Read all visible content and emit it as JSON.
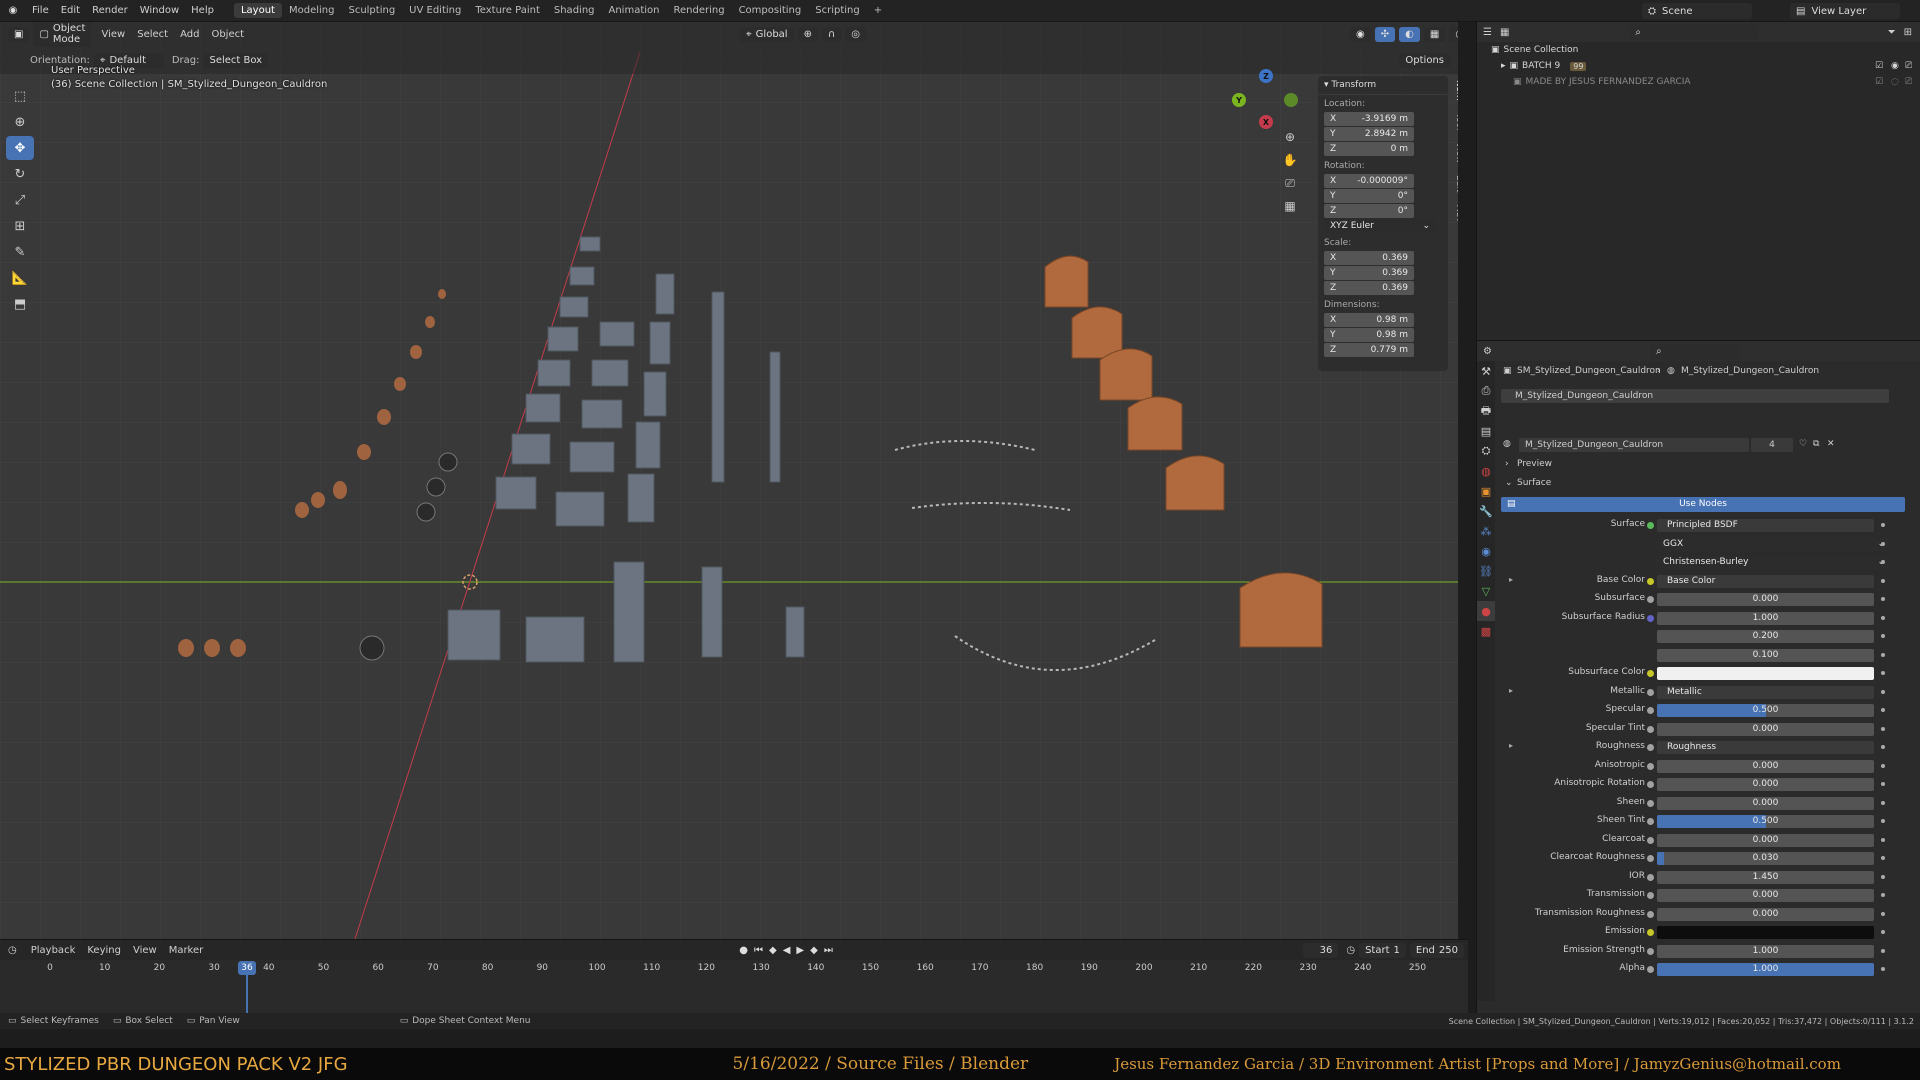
{
  "topbar": {
    "menus": [
      "File",
      "Edit",
      "Render",
      "Window",
      "Help"
    ],
    "workspaces": [
      "Layout",
      "Modeling",
      "Sculpting",
      "UV Editing",
      "Texture Paint",
      "Shading",
      "Animation",
      "Rendering",
      "Compositing",
      "Scripting"
    ],
    "active_workspace": "Layout",
    "add_workspace": "+",
    "scene": "Scene",
    "view_layer": "View Layer"
  },
  "viewport": {
    "mode": "Object Mode",
    "menus": [
      "View",
      "Select",
      "Add",
      "Object"
    ],
    "transform_orientation": "Global",
    "orientation_label": "Orientation:",
    "orientation_value": "Default",
    "drag_label": "Drag:",
    "drag_value": "Select Box",
    "options_label": "Options",
    "view_name": "User Perspective",
    "collection_info": "(36) Scene Collection | SM_Stylized_Dungeon_Cauldron",
    "gizmo": {
      "x": "X",
      "y": "Y",
      "z": "Z"
    }
  },
  "npanel": {
    "title": "Transform",
    "location_label": "Location:",
    "location": {
      "x": "-3.9169 m",
      "y": "2.8942 m",
      "z": "0 m"
    },
    "rotation_label": "Rotation:",
    "rotation": {
      "x": "-0.000009°",
      "y": "0°",
      "z": "0°"
    },
    "rotation_mode": "XYZ Euler",
    "scale_label": "Scale:",
    "scale": {
      "x": "0.369",
      "y": "0.369",
      "z": "0.369"
    },
    "dimensions_label": "Dimensions:",
    "dimensions": {
      "x": "0.98 m",
      "y": "0.98 m",
      "z": "0.779 m"
    },
    "axis": {
      "x": "X",
      "y": "Y",
      "z": "Z"
    },
    "tabs": [
      "Item",
      "Tool",
      "View",
      "Edit",
      "ACT"
    ]
  },
  "outliner": {
    "root": "Scene Collection",
    "items": [
      {
        "label": "BATCH 9",
        "badge": "99"
      },
      {
        "label": "MADE BY JESUS FERNANDEZ GARCIA"
      }
    ]
  },
  "properties": {
    "breadcrumb_object": "SM_Stylized_Dungeon_Cauldron",
    "breadcrumb_material": "M_Stylized_Dungeon_Cauldron",
    "slot": "M_Stylized_Dungeon_Cauldron",
    "material_name": "M_Stylized_Dungeon_Cauldron",
    "user_count": "4",
    "preview_label": "Preview",
    "surface_label": "Surface",
    "use_nodes": "Use Nodes",
    "rows": [
      {
        "label": "Surface",
        "value": "Principled BSDF",
        "kind": "link",
        "dot": "#5aba5a"
      },
      {
        "label": "",
        "value": "GGX",
        "kind": "dropdown"
      },
      {
        "label": "",
        "value": "Christensen-Burley",
        "kind": "dropdown"
      },
      {
        "label": "Base Color",
        "value": "Base Color",
        "kind": "link",
        "dot": "#c7c729",
        "expand": true
      },
      {
        "label": "Subsurface",
        "value": "0.000",
        "kind": "num",
        "fill": 0
      },
      {
        "label": "Subsurface Radius",
        "value": "1.000",
        "kind": "num",
        "fill": 0,
        "dot": "#6363c7"
      },
      {
        "label": "",
        "value": "0.200",
        "kind": "num",
        "fill": 0,
        "nodot": true
      },
      {
        "label": "",
        "value": "0.100",
        "kind": "num",
        "fill": 0,
        "nodot": true
      },
      {
        "label": "Subsurface Color",
        "value": "",
        "kind": "white",
        "dot": "#c7c729"
      },
      {
        "label": "Metallic",
        "value": "Metallic",
        "kind": "link",
        "expand": true
      },
      {
        "label": "Specular",
        "value": "0.500",
        "kind": "num",
        "fill": 0.5
      },
      {
        "label": "Specular Tint",
        "value": "0.000",
        "kind": "num",
        "fill": 0
      },
      {
        "label": "Roughness",
        "value": "Roughness",
        "kind": "link",
        "expand": true
      },
      {
        "label": "Anisotropic",
        "value": "0.000",
        "kind": "num",
        "fill": 0
      },
      {
        "label": "Anisotropic Rotation",
        "value": "0.000",
        "kind": "num",
        "fill": 0
      },
      {
        "label": "Sheen",
        "value": "0.000",
        "kind": "num",
        "fill": 0
      },
      {
        "label": "Sheen Tint",
        "value": "0.500",
        "kind": "num",
        "fill": 0.5
      },
      {
        "label": "Clearcoat",
        "value": "0.000",
        "kind": "num",
        "fill": 0
      },
      {
        "label": "Clearcoat Roughness",
        "value": "0.030",
        "kind": "num",
        "fill": 0.03
      },
      {
        "label": "IOR",
        "value": "1.450",
        "kind": "num",
        "fill": 0
      },
      {
        "label": "Transmission",
        "value": "0.000",
        "kind": "num",
        "fill": 0
      },
      {
        "label": "Transmission Roughness",
        "value": "0.000",
        "kind": "num",
        "fill": 0
      },
      {
        "label": "Emission",
        "value": "",
        "kind": "black",
        "dot": "#c7c729"
      },
      {
        "label": "Emission Strength",
        "value": "1.000",
        "kind": "num",
        "fill": 0
      },
      {
        "label": "Alpha",
        "value": "1.000",
        "kind": "num",
        "fill": 1
      }
    ]
  },
  "timeline": {
    "menus": [
      "Playback",
      "Keying",
      "View",
      "Marker"
    ],
    "current_frame": "36",
    "start_label": "Start",
    "start": "1",
    "end_label": "End",
    "end": "250",
    "ticks": [
      "0",
      "10",
      "20",
      "30",
      "40",
      "50",
      "60",
      "70",
      "80",
      "90",
      "100",
      "110",
      "120",
      "130",
      "140",
      "150",
      "160",
      "170",
      "180",
      "190",
      "200",
      "210",
      "220",
      "230",
      "240",
      "250"
    ]
  },
  "statusbar": {
    "hint1": "Select Keyframes",
    "hint2": "Box Select",
    "hint3": "Pan View",
    "hint4": "Dope Sheet Context Menu",
    "stats": "Scene Collection | SM_Stylized_Dungeon_Cauldron | Verts:19,012 | Faces:20,052 | Tris:37,472 | Objects:0/111 | 3.1.2"
  },
  "banner": {
    "left": "STYLIZED PBR DUNGEON PACK V2 JFG",
    "middle": "5/16/2022 / Source Files / Blender",
    "right": "Jesus Fernandez Garcia / 3D Environment Artist [Props and More] / JamyzGenius@hotmail.com"
  },
  "colors": {
    "accent": "#4772b3",
    "banner_text": "#d99a3a",
    "x_axis": "#c43c4b",
    "y_axis": "#7ab51f",
    "z_axis": "#3c73c4",
    "cauldron": "#b06a3d"
  }
}
